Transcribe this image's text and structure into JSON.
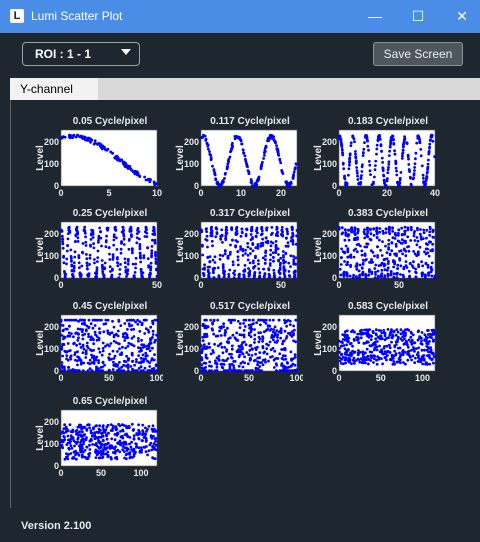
{
  "window": {
    "title": "Lumi Scatter Plot",
    "app_icon": "L"
  },
  "window_controls": {
    "minimize": "—",
    "maximize": "☐",
    "close": "✕"
  },
  "toolbar": {
    "roi_value": "ROI : 1 - 1",
    "save_label": "Save Screen"
  },
  "tabs": [
    {
      "label": "Y-channel",
      "selected": true
    }
  ],
  "footer": {
    "version": "Version 2.100"
  },
  "marker_color": "#0000ff",
  "chart_data": [
    {
      "type": "scatter",
      "title": "0.05 Cycle/pixel",
      "ylabel": "Level",
      "xlim": [
        0,
        10
      ],
      "ylim": [
        0,
        255
      ],
      "xticks": [
        "0",
        "5",
        "10"
      ],
      "yticks": [
        "0",
        "100",
        "200"
      ],
      "frequency": 0.05,
      "grid": false
    },
    {
      "type": "scatter",
      "title": "0.117 Cycle/pixel",
      "ylabel": "Level",
      "xlim": [
        0,
        24
      ],
      "ylim": [
        0,
        255
      ],
      "xticks": [
        "0",
        "10",
        "20"
      ],
      "yticks": [
        "0",
        "100",
        "200"
      ],
      "frequency": 0.117,
      "grid": false
    },
    {
      "type": "scatter",
      "title": "0.183 Cycle/pixel",
      "ylabel": "Level",
      "xlim": [
        0,
        40
      ],
      "ylim": [
        0,
        255
      ],
      "xticks": [
        "0",
        "20",
        "40"
      ],
      "yticks": [
        "0",
        "100",
        "200"
      ],
      "frequency": 0.183,
      "grid": false
    },
    {
      "type": "scatter",
      "title": "0.25 Cycle/pixel",
      "ylabel": "Level",
      "xlim": [
        0,
        50
      ],
      "ylim": [
        0,
        255
      ],
      "xticks": [
        "0",
        "50"
      ],
      "yticks": [
        "0",
        "100",
        "200"
      ],
      "frequency": 0.25,
      "grid": false
    },
    {
      "type": "scatter",
      "title": "0.317 Cycle/pixel",
      "ylabel": "Level",
      "xlim": [
        0,
        60
      ],
      "ylim": [
        0,
        255
      ],
      "xticks": [
        "0",
        "50"
      ],
      "yticks": [
        "0",
        "100",
        "200"
      ],
      "frequency": 0.317,
      "grid": false
    },
    {
      "type": "scatter",
      "title": "0.383 Cycle/pixel",
      "ylabel": "Level",
      "xlim": [
        0,
        80
      ],
      "ylim": [
        0,
        255
      ],
      "xticks": [
        "0",
        "50"
      ],
      "yticks": [
        "0",
        "100",
        "200"
      ],
      "frequency": 0.383,
      "grid": false
    },
    {
      "type": "scatter",
      "title": "0.45 Cycle/pixel",
      "ylabel": "Level",
      "xlim": [
        0,
        100
      ],
      "ylim": [
        0,
        255
      ],
      "xticks": [
        "0",
        "50",
        "100"
      ],
      "yticks": [
        "0",
        "100",
        "200"
      ],
      "frequency": 0.45,
      "grid": false
    },
    {
      "type": "scatter",
      "title": "0.517 Cycle/pixel",
      "ylabel": "Level",
      "xlim": [
        0,
        100
      ],
      "ylim": [
        0,
        255
      ],
      "xticks": [
        "0",
        "50",
        "100"
      ],
      "yticks": [
        "0",
        "100",
        "200"
      ],
      "frequency": 0.517,
      "grid": false
    },
    {
      "type": "scatter",
      "title": "0.583 Cycle/pixel",
      "ylabel": "Level",
      "xlim": [
        0,
        115
      ],
      "ylim": [
        0,
        255
      ],
      "xticks": [
        "0",
        "50",
        "100"
      ],
      "yticks": [
        "0",
        "100",
        "200"
      ],
      "frequency": 0.583,
      "grid": false
    },
    {
      "type": "scatter",
      "title": "0.65 Cycle/pixel",
      "ylabel": "Level",
      "xlim": [
        0,
        120
      ],
      "ylim": [
        0,
        255
      ],
      "xticks": [
        "0",
        "50",
        "100"
      ],
      "yticks": [
        "0",
        "100",
        "200"
      ],
      "frequency": 0.65,
      "grid": false
    }
  ]
}
